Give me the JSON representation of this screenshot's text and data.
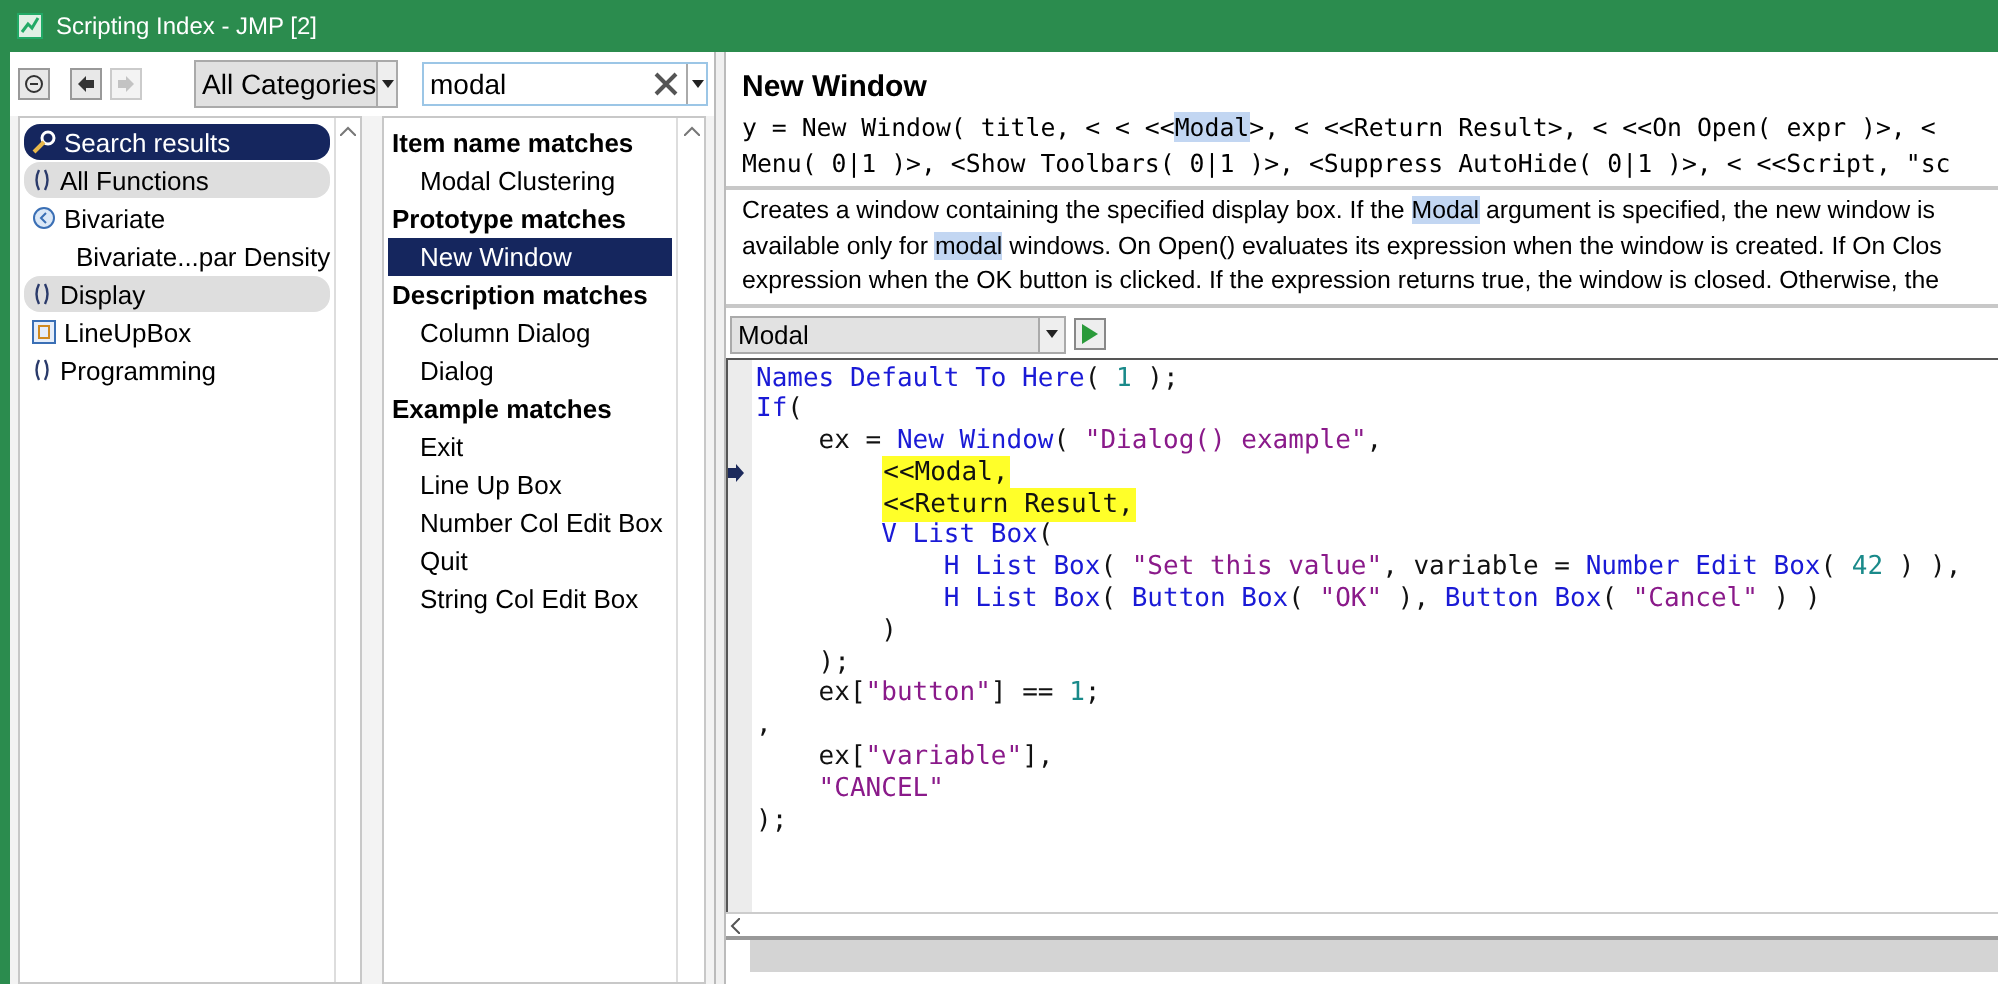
{
  "window": {
    "title": "Scripting Index - JMP [2]"
  },
  "toolbar": {
    "category": "All Categories",
    "search": "modal"
  },
  "categories": [
    {
      "label": "Search results",
      "kind": "search",
      "selected": true,
      "shaded": false
    },
    {
      "label": "All Functions",
      "kind": "function",
      "selected": false,
      "shaded": true
    },
    {
      "label": "Bivariate",
      "kind": "platform",
      "selected": false,
      "shaded": false,
      "children": [
        {
          "label": "Bivariate...par Density",
          "selected": false,
          "shaded": false
        }
      ]
    },
    {
      "label": "Display",
      "kind": "function",
      "selected": false,
      "shaded": true
    },
    {
      "label": "LineUpBox",
      "kind": "object",
      "selected": false,
      "shaded": false
    },
    {
      "label": "Programming",
      "kind": "function",
      "selected": false,
      "shaded": false
    }
  ],
  "results": [
    {
      "heading": "Item name matches",
      "items": [
        {
          "label": "Modal Clustering",
          "selected": false
        }
      ]
    },
    {
      "heading": "Prototype matches",
      "items": [
        {
          "label": "New Window",
          "selected": true
        }
      ]
    },
    {
      "heading": "Description matches",
      "items": [
        {
          "label": "Column Dialog",
          "selected": false
        },
        {
          "label": "Dialog",
          "selected": false
        }
      ]
    },
    {
      "heading": "Example matches",
      "items": [
        {
          "label": "Exit",
          "selected": false
        },
        {
          "label": "Line Up Box",
          "selected": false
        },
        {
          "label": "Number Col Edit Box",
          "selected": false
        },
        {
          "label": "Quit",
          "selected": false
        },
        {
          "label": "String Col Edit Box",
          "selected": false
        }
      ]
    }
  ],
  "detail": {
    "title": "New Window",
    "prototype": [
      [
        {
          "text": "y = New Window( title, < < <<",
          "highlighted": false
        },
        {
          "text": "Modal",
          "highlighted": true
        },
        {
          "text": ">, < <<Return Result>, < <<On Open( expr )>, <",
          "highlighted": false
        }
      ],
      [
        {
          "text": "Menu( 0|1 )>, <Show Toolbars( 0|1 )>, <Suppress AutoHide( 0|1 )>, < <<Script, \"sc",
          "highlighted": false
        }
      ]
    ],
    "description": [
      [
        {
          "text": "Creates a window containing the specified display box. If the ",
          "highlighted": false
        },
        {
          "text": "Modal",
          "highlighted": true
        },
        {
          "text": " argument is specified, the new window is",
          "highlighted": false
        }
      ],
      [
        {
          "text": "available only for ",
          "highlighted": false
        },
        {
          "text": "modal",
          "highlighted": true
        },
        {
          "text": " windows. On Open() evaluates its expression when the window is created. If On Clos",
          "highlighted": false
        }
      ],
      [
        {
          "text": "expression when the OK button is clicked. If the expression returns true, the window is closed. Otherwise, the",
          "highlighted": false
        }
      ]
    ]
  },
  "example": {
    "selector": "Modal"
  },
  "code": {
    "lines": [
      {
        "marker": false,
        "highlighted": false,
        "tokens": [
          {
            "text": "Names Default To Here",
            "kind": "function"
          },
          {
            "text": "( ",
            "kind": "plain"
          },
          {
            "text": "1",
            "kind": "number"
          },
          {
            "text": " );",
            "kind": "plain"
          }
        ]
      },
      {
        "marker": false,
        "highlighted": false,
        "tokens": [
          {
            "text": "If",
            "kind": "function"
          },
          {
            "text": "(",
            "kind": "plain"
          }
        ]
      },
      {
        "marker": false,
        "highlighted": false,
        "tokens": [
          {
            "text": "    ex = ",
            "kind": "plain"
          },
          {
            "text": "New Window",
            "kind": "function"
          },
          {
            "text": "( ",
            "kind": "plain"
          },
          {
            "text": "\"Dialog() example\"",
            "kind": "string"
          },
          {
            "text": ",",
            "kind": "plain"
          }
        ]
      },
      {
        "marker": true,
        "highlighted": true,
        "tokens": [
          {
            "text": "        <<Modal,",
            "kind": "plain"
          }
        ]
      },
      {
        "marker": false,
        "highlighted": true,
        "tokens": [
          {
            "text": "        <<Return Result,",
            "kind": "plain"
          }
        ]
      },
      {
        "marker": false,
        "highlighted": false,
        "tokens": [
          {
            "text": "        V List Box",
            "kind": "function"
          },
          {
            "text": "(",
            "kind": "plain"
          }
        ]
      },
      {
        "marker": false,
        "highlighted": false,
        "tokens": [
          {
            "text": "            H List Box",
            "kind": "function"
          },
          {
            "text": "( ",
            "kind": "plain"
          },
          {
            "text": "\"Set this value\"",
            "kind": "string"
          },
          {
            "text": ", variable = ",
            "kind": "plain"
          },
          {
            "text": "Number Edit Box",
            "kind": "function"
          },
          {
            "text": "( ",
            "kind": "plain"
          },
          {
            "text": "42",
            "kind": "number"
          },
          {
            "text": " ) ),",
            "kind": "plain"
          }
        ]
      },
      {
        "marker": false,
        "highlighted": false,
        "tokens": [
          {
            "text": "            H List Box",
            "kind": "function"
          },
          {
            "text": "( ",
            "kind": "plain"
          },
          {
            "text": "Button Box",
            "kind": "function"
          },
          {
            "text": "( ",
            "kind": "plain"
          },
          {
            "text": "\"OK\"",
            "kind": "string"
          },
          {
            "text": " ), ",
            "kind": "plain"
          },
          {
            "text": "Button Box",
            "kind": "function"
          },
          {
            "text": "( ",
            "kind": "plain"
          },
          {
            "text": "\"Cancel\"",
            "kind": "string"
          },
          {
            "text": " ) )",
            "kind": "plain"
          }
        ]
      },
      {
        "marker": false,
        "highlighted": false,
        "tokens": [
          {
            "text": "        )",
            "kind": "plain"
          }
        ]
      },
      {
        "marker": false,
        "highlighted": false,
        "tokens": [
          {
            "text": "    );",
            "kind": "plain"
          }
        ]
      },
      {
        "marker": false,
        "highlighted": false,
        "tokens": [
          {
            "text": "    ex[",
            "kind": "plain"
          },
          {
            "text": "\"button\"",
            "kind": "string"
          },
          {
            "text": "] == ",
            "kind": "plain"
          },
          {
            "text": "1",
            "kind": "number"
          },
          {
            "text": ";",
            "kind": "plain"
          }
        ]
      },
      {
        "marker": false,
        "highlighted": false,
        "tokens": [
          {
            "text": ",",
            "kind": "plain"
          }
        ]
      },
      {
        "marker": false,
        "highlighted": false,
        "tokens": [
          {
            "text": "    ex[",
            "kind": "plain"
          },
          {
            "text": "\"variable\"",
            "kind": "string"
          },
          {
            "text": "],",
            "kind": "plain"
          }
        ]
      },
      {
        "marker": false,
        "highlighted": false,
        "tokens": [
          {
            "text": "    \"CANCEL\"",
            "kind": "string"
          }
        ]
      },
      {
        "marker": false,
        "highlighted": false,
        "tokens": [
          {
            "text": ");",
            "kind": "plain"
          }
        ]
      }
    ]
  }
}
